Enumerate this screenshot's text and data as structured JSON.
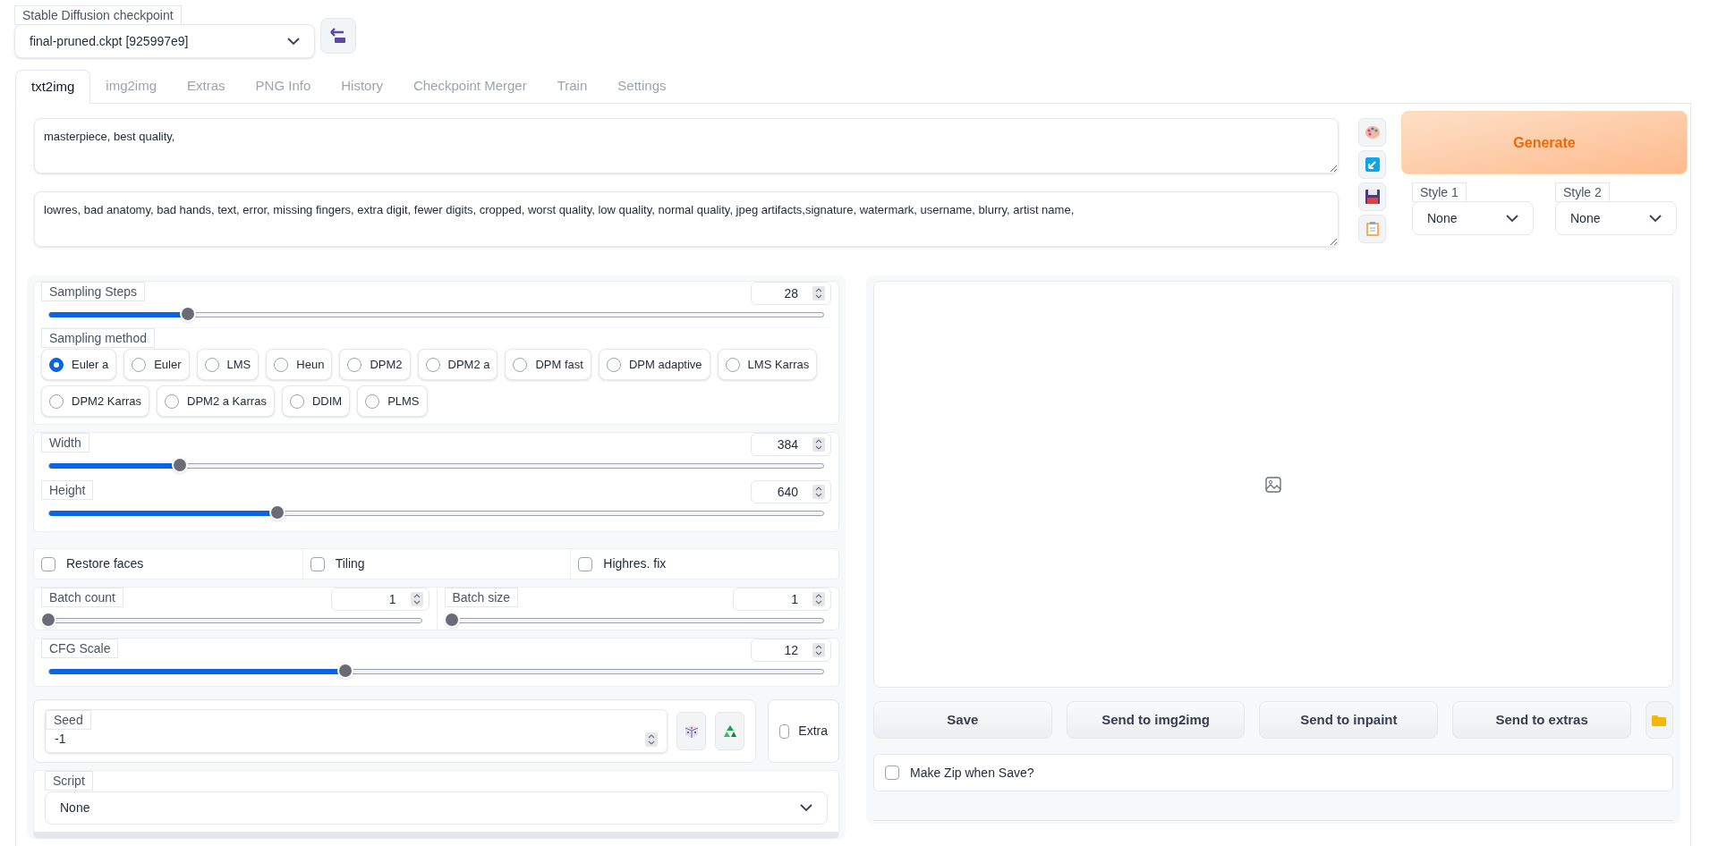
{
  "checkpoint": {
    "label": "Stable Diffusion checkpoint",
    "value": "final-pruned.ckpt [925997e9]"
  },
  "tabs": [
    {
      "label": "txt2img",
      "selected": true
    },
    {
      "label": "img2img",
      "selected": false
    },
    {
      "label": "Extras",
      "selected": false
    },
    {
      "label": "PNG Info",
      "selected": false
    },
    {
      "label": "History",
      "selected": false
    },
    {
      "label": "Checkpoint Merger",
      "selected": false
    },
    {
      "label": "Train",
      "selected": false
    },
    {
      "label": "Settings",
      "selected": false
    }
  ],
  "prompt": {
    "value": "masterpiece, best quality,"
  },
  "negative_prompt": {
    "value": "lowres, bad anatomy, bad hands, text, error, missing fingers, extra digit, fewer digits, cropped, worst quality, low quality, normal quality, jpeg artifacts,signature, watermark, username, blurry, artist name,"
  },
  "generate_button": {
    "label": "Generate"
  },
  "styles": [
    {
      "label": "Style 1",
      "value": "None"
    },
    {
      "label": "Style 2",
      "value": "None"
    }
  ],
  "sampling_steps": {
    "label": "Sampling Steps",
    "value": "28",
    "level": 0.18
  },
  "sampling_method": {
    "label": "Sampling method",
    "options": [
      {
        "label": "Euler a",
        "selected": true
      },
      {
        "label": "Euler",
        "selected": false
      },
      {
        "label": "LMS",
        "selected": false
      },
      {
        "label": "Heun",
        "selected": false
      },
      {
        "label": "DPM2",
        "selected": false
      },
      {
        "label": "DPM2 a",
        "selected": false
      },
      {
        "label": "DPM fast",
        "selected": false
      },
      {
        "label": "DPM adaptive",
        "selected": false
      },
      {
        "label": "LMS Karras",
        "selected": false
      },
      {
        "label": "DPM2 Karras",
        "selected": false
      },
      {
        "label": "DPM2 a Karras",
        "selected": false
      },
      {
        "label": "DDIM",
        "selected": false
      },
      {
        "label": "PLMS",
        "selected": false
      }
    ]
  },
  "width": {
    "label": "Width",
    "value": "384",
    "level": 0.17
  },
  "height": {
    "label": "Height",
    "value": "640",
    "level": 0.295
  },
  "options": [
    {
      "label": "Restore faces",
      "checked": false
    },
    {
      "label": "Tiling",
      "checked": false
    },
    {
      "label": "Highres. fix",
      "checked": false
    }
  ],
  "batch_count": {
    "label": "Batch count",
    "value": "1",
    "level": 0
  },
  "batch_size": {
    "label": "Batch size",
    "value": "1",
    "level": 0
  },
  "cfg_scale": {
    "label": "CFG Scale",
    "value": "12",
    "level": 0.383
  },
  "seed": {
    "label": "Seed",
    "value": "-1"
  },
  "extra": {
    "label": "Extra",
    "checked": false
  },
  "script": {
    "label": "Script",
    "value": "None"
  },
  "output_buttons": [
    {
      "label": "Save"
    },
    {
      "label": "Send to img2img"
    },
    {
      "label": "Send to inpaint"
    },
    {
      "label": "Send to extras"
    }
  ],
  "make_zip": {
    "label": "Make Zip when Save?",
    "checked": false
  }
}
